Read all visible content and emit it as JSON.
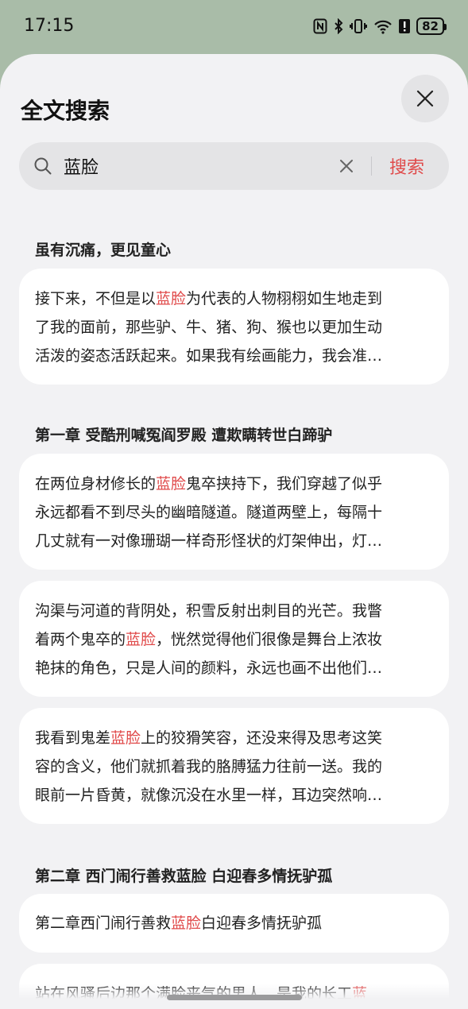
{
  "status": {
    "time": "17:15",
    "battery": "82"
  },
  "sheet": {
    "title": "全文搜索",
    "search": {
      "query": "蓝脸",
      "submit_label": "搜索"
    }
  },
  "results": [
    {
      "chapter": "虽有沉痛，更见童心",
      "snippets": [
        {
          "lines": [
            [
              "接下来，不但是以",
              {
                "hl": "蓝脸"
              },
              "为代表的人物栩栩如生地走到"
            ],
            [
              "了我的面前，那些驴、牛、猪、狗、猴也以更加生动"
            ],
            [
              "活泼的姿态活跃起来。如果我有绘画能力，我会准…"
            ]
          ]
        }
      ]
    },
    {
      "chapter": "第一章 受酷刑喊冤阎罗殿 遭欺瞒转世白蹄驴",
      "snippets": [
        {
          "lines": [
            [
              "在两位身材修长的",
              {
                "hl": "蓝脸"
              },
              "鬼卒挟持下，我们穿越了似乎"
            ],
            [
              "永远都看不到尽头的幽暗隧道。隧道两壁上，每隔十"
            ],
            [
              "几丈就有一对像珊瑚一样奇形怪状的灯架伸出，灯…"
            ]
          ]
        },
        {
          "lines": [
            [
              "沟渠与河道的背阴处，积雪反射出刺目的光芒。我瞥"
            ],
            [
              "着两个鬼卒的",
              {
                "hl": "蓝脸"
              },
              "，恍然觉得他们很像是舞台上浓妆"
            ],
            [
              "艳抹的角色，只是人间的颜料，永远也画不出他们…"
            ]
          ]
        },
        {
          "lines": [
            [
              "我看到鬼差",
              {
                "hl": "蓝脸"
              },
              "上的狡猾笑容，还没来得及思考这笑"
            ],
            [
              "容的含义，他们就抓着我的胳膊猛力往前一送。我的"
            ],
            [
              "眼前一片昏黄，就像沉没在水里一样，耳边突然响…"
            ]
          ]
        }
      ]
    },
    {
      "chapter": "第二章 西门闹行善救蓝脸 白迎春多情抚驴孤",
      "snippets": [
        {
          "lines": [
            [
              "第二章西门闹行善救",
              {
                "hl": "蓝脸"
              },
              "白迎春多情抚驴孤"
            ]
          ]
        },
        {
          "lines": [
            [
              "站在风骚后边那个满脸丧气的男人，是我的长工",
              {
                "hl": "蓝"
              }
            ]
          ]
        }
      ]
    }
  ]
}
